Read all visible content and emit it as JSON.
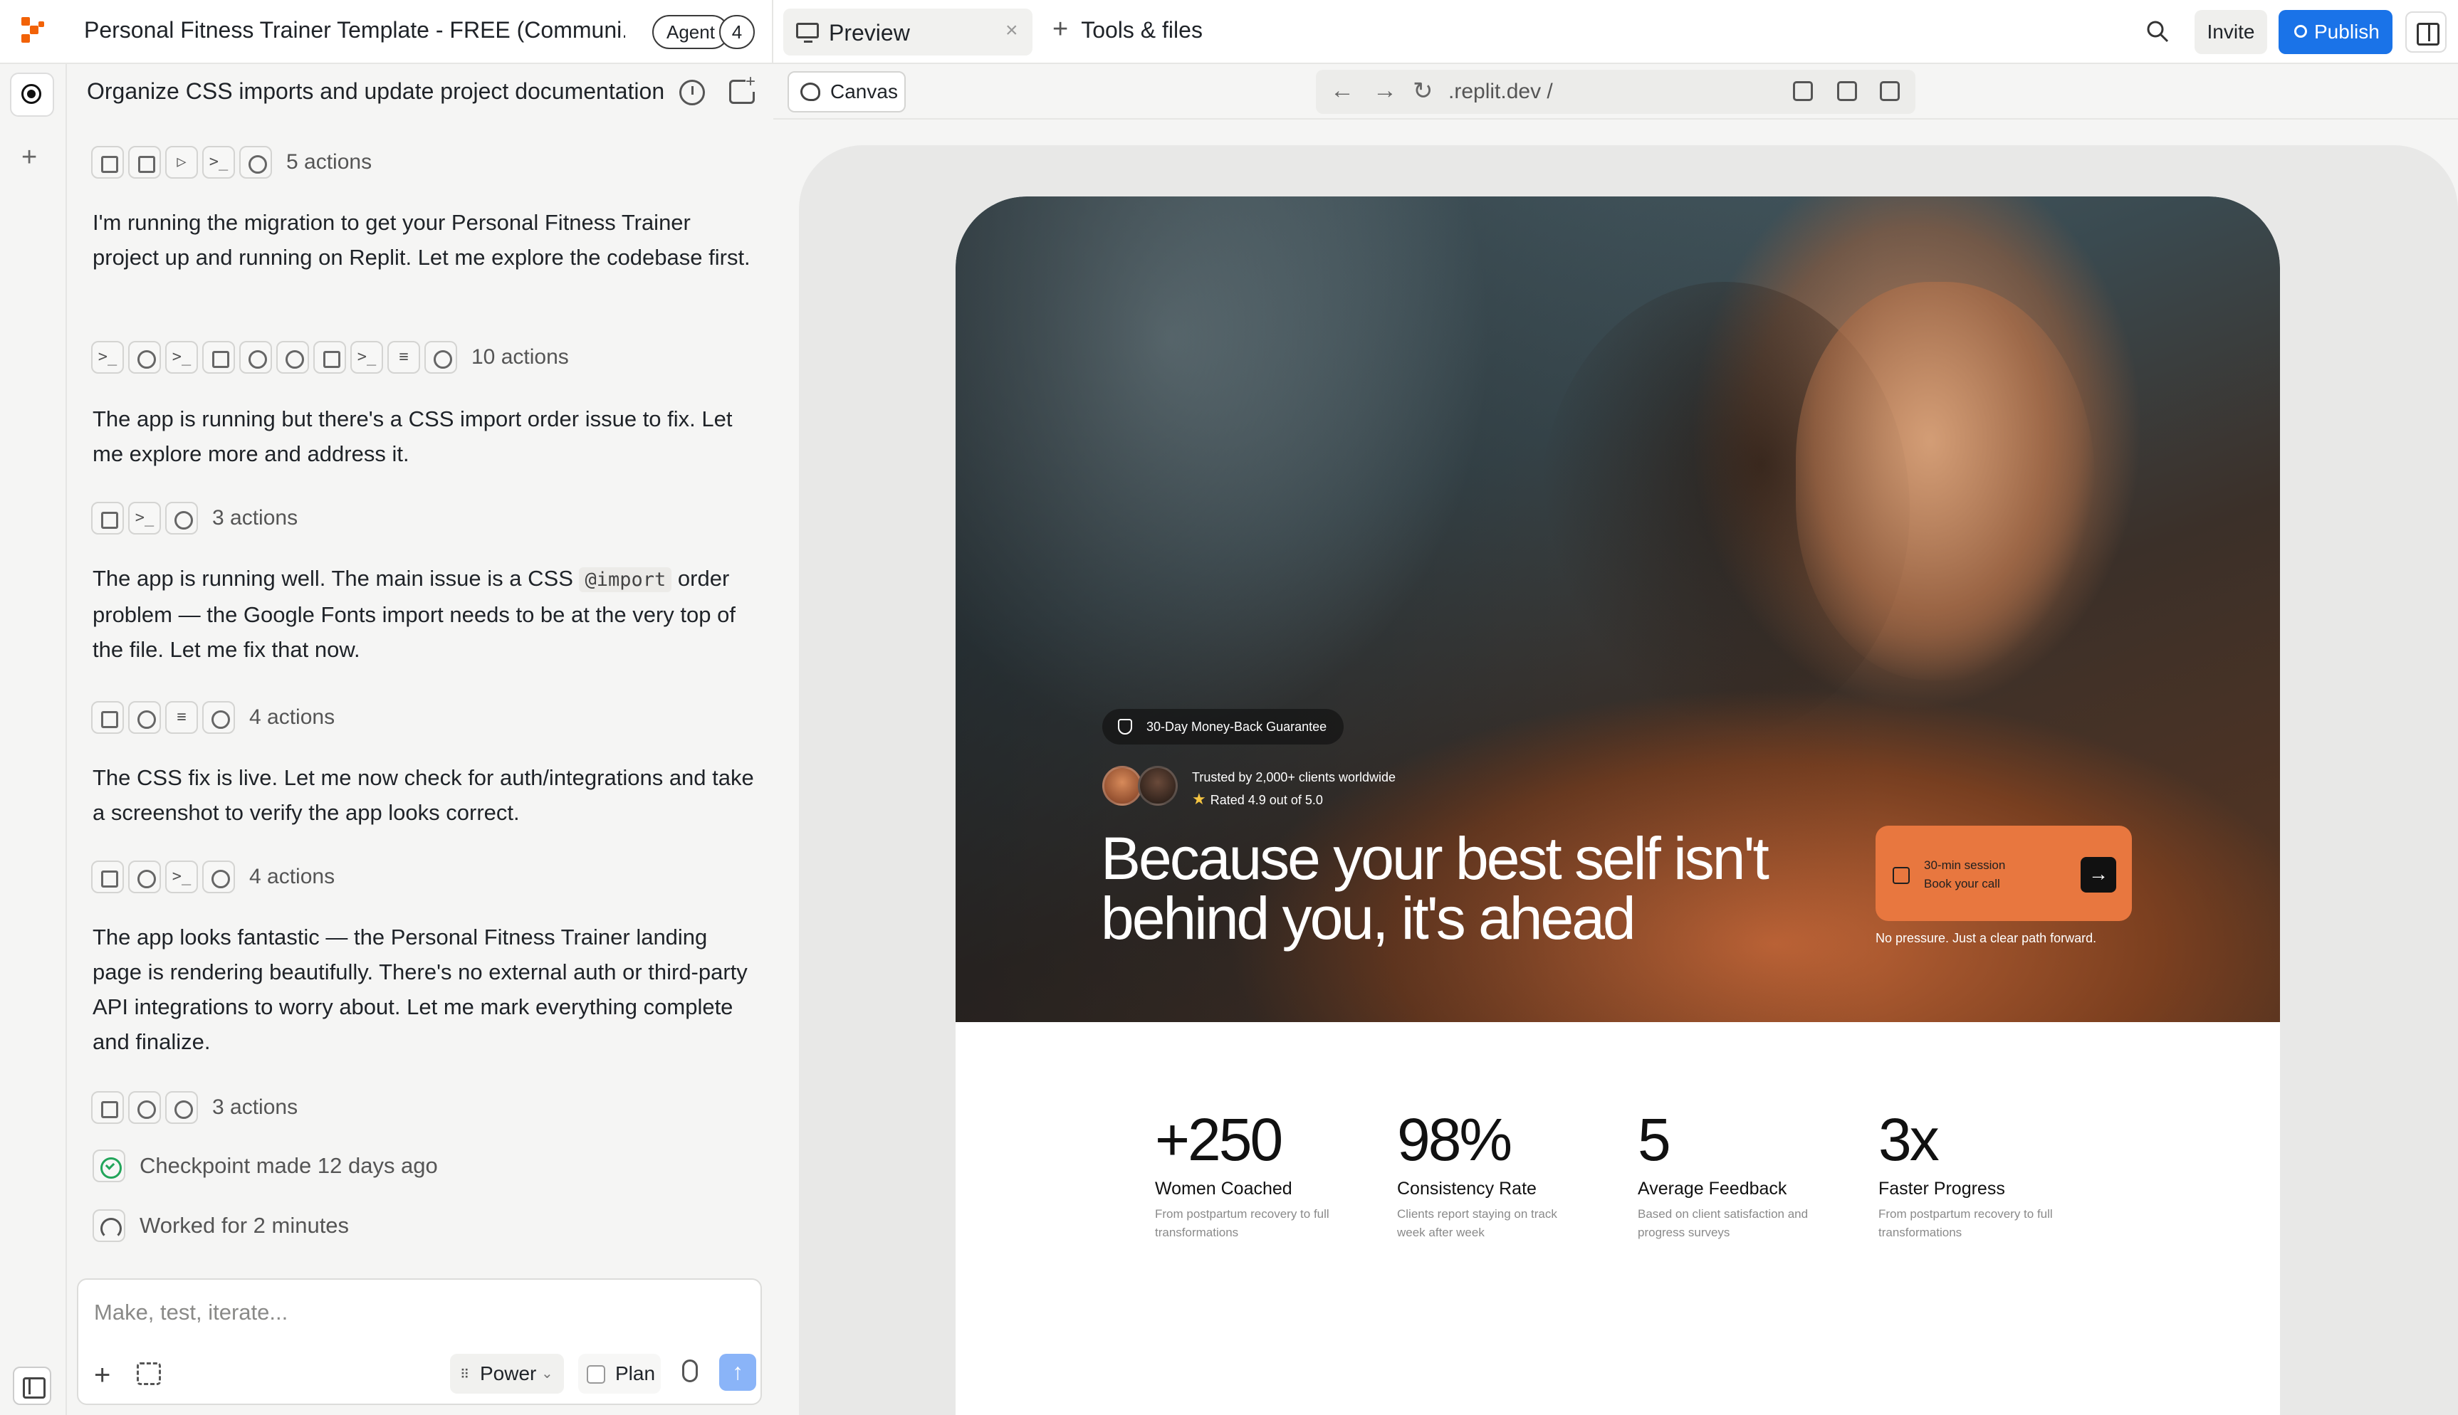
{
  "header": {
    "project_title": "Personal Fitness Trainer Template - FREE (Communi...",
    "agent_label": "Agent",
    "agent_count": "4",
    "preview_tab": "Preview",
    "tools_tab": "Tools & files",
    "invite": "Invite",
    "publish": "Publish"
  },
  "chat": {
    "title": "Organize CSS imports and update project documentation",
    "action_groups": [
      {
        "label": "5 actions"
      },
      {
        "label": "10 actions"
      },
      {
        "label": "3 actions"
      },
      {
        "label": "4 actions"
      },
      {
        "label": "4 actions"
      },
      {
        "label": "3 actions"
      }
    ],
    "messages": [
      "I'm running the migration to get your Personal Fitness Trainer project up and running on Replit. Let me explore the codebase first.",
      "The app is running but there's a CSS import order issue to fix. Let me explore more and address it.",
      {
        "before": "The app is running well. The main issue is a CSS ",
        "code": "@import",
        "after": " order problem — the Google Fonts import needs to be at the very top of the file. Let me fix that now."
      },
      "The CSS fix is live. Let me now check for auth/integrations and take a screenshot to verify the app looks correct.",
      "The app looks fantastic — the Personal Fitness Trainer landing page is rendering beautifully. There's no external auth or third-party API integrations to worry about. Let me mark everything complete and finalize."
    ],
    "checkpoint": "Checkpoint made 12 days ago",
    "worked": "Worked for 2 minutes",
    "composer": {
      "placeholder": "Make, test, iterate...",
      "mode": "Power",
      "plan": "Plan"
    }
  },
  "preview": {
    "canvas_label": "Canvas",
    "url": ".replit.dev /",
    "site": {
      "guarantee": "30-Day Money-Back Guarantee",
      "trusted": "Trusted by 2,000+ clients worldwide",
      "rated": "Rated 4.9 out of 5.0",
      "headline": "Because your best self isn't behind you, it's ahead",
      "book_line1": "30-min session",
      "book_line2": "Book your call",
      "no_pressure": "No pressure. Just a clear path forward.",
      "stats": [
        {
          "num": "+250",
          "label": "Women Coached",
          "desc": "From postpartum recovery to full transformations"
        },
        {
          "num": "98%",
          "label": "Consistency Rate",
          "desc": "Clients report staying on track week after week"
        },
        {
          "num": "5",
          "label": "Average Feedback",
          "desc": "Based on client satisfaction and progress surveys"
        },
        {
          "num": "3x",
          "label": "Faster Progress",
          "desc": "From postpartum recovery to full transformations"
        }
      ]
    }
  },
  "colors": {
    "accent_blue": "#1a73e8",
    "accent_orange": "#e8773f",
    "brand_orange": "#f26207",
    "check_green": "#22a55a"
  }
}
